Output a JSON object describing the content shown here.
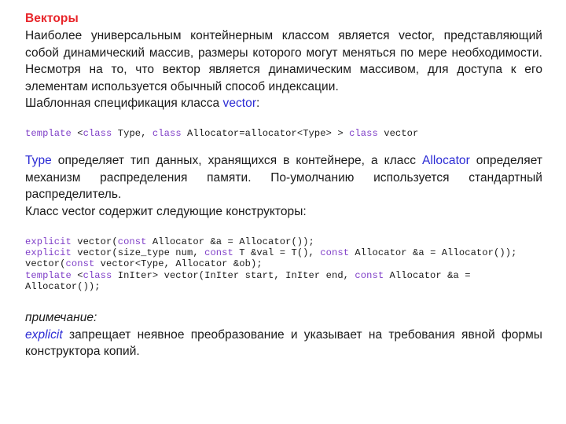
{
  "slide": {
    "title": "Векторы",
    "colors": {
      "title_red": "#e8252a",
      "identifier_blue": "#2b2bd4",
      "code_keyword_purple": "#8040c8",
      "body_text": "#1a1a1a",
      "background": "#ffffff"
    },
    "paragraph_1": {
      "line_1": "Наиболее универсальным контейнерным классом является vector,",
      "line_2": "представляющий собой динамический массив, размеры которого",
      "line_3": "могут меняться по мере необходимости. Несмотря на то, что вектор",
      "line_4": "является динамическим массивом, для доступа к его элементам",
      "line_5": "используется обычный способ индексации.",
      "full": "Наиболее универсальным контейнерным классом является vector, представляющий собой динамический массив, размеры которого могут меняться по мере необходимости. Несмотря на то, что вектор является динамическим массивом, для доступа к его элементам используется обычный способ индексации."
    },
    "spec_intro": {
      "before": "Шаблонная спецификация класса ",
      "identifier": "vector",
      "after": ":"
    },
    "code_block_1": {
      "tokens": [
        {
          "text": "template",
          "style": "keyword"
        },
        {
          "text": " <",
          "style": "plain"
        },
        {
          "text": "class",
          "style": "keyword"
        },
        {
          "text": " Type, ",
          "style": "plain"
        },
        {
          "text": "class",
          "style": "keyword"
        },
        {
          "text": " Allocator=allocator<Type> > ",
          "style": "plain"
        },
        {
          "text": "class",
          "style": "keyword"
        },
        {
          "text": " vector",
          "style": "plain"
        }
      ],
      "plain_text": "template <class Type, class Allocator=allocator<Type> > class vector"
    },
    "paragraph_2": {
      "identifier_1": "Type",
      "mid_1": " определяет тип данных, хранящихся в контейнере, а класс ",
      "identifier_2": "Allocator",
      "mid_2": " определяет механизм распределения памяти. По-умолчанию используется стандартный распределитель.",
      "full": "Type определяет тип данных, хранящихся в контейнере, а класс Allocator определяет механизм распределения памяти. По-умолчанию используется стандартный распределитель."
    },
    "constructors_intro": "Класс vector содержит следующие конструкторы:",
    "code_block_2": {
      "lines": [
        {
          "tokens": [
            {
              "text": "explicit",
              "style": "keyword"
            },
            {
              "text": " vector(",
              "style": "plain"
            },
            {
              "text": "const",
              "style": "keyword"
            },
            {
              "text": " Allocator &a = Allocator());",
              "style": "plain"
            }
          ],
          "plain_text": "explicit vector(const Allocator &a = Allocator());"
        },
        {
          "tokens": [
            {
              "text": "explicit",
              "style": "keyword"
            },
            {
              "text": " vector(size_type num, ",
              "style": "plain"
            },
            {
              "text": "const",
              "style": "keyword"
            },
            {
              "text": " T &val = T(), ",
              "style": "plain"
            },
            {
              "text": "const",
              "style": "keyword"
            },
            {
              "text": " Allocator &a = Allocator());",
              "style": "plain"
            }
          ],
          "plain_text": "explicit vector(size_type num, const T &val = T(), const Allocator &a = Allocator());"
        },
        {
          "tokens": [
            {
              "text": "vector(",
              "style": "plain"
            },
            {
              "text": "const",
              "style": "keyword"
            },
            {
              "text": " vector<Type, Allocator &ob);",
              "style": "plain"
            }
          ],
          "plain_text": "vector(const vector<Type, Allocator &ob);"
        },
        {
          "tokens": [
            {
              "text": "template",
              "style": "keyword"
            },
            {
              "text": " <",
              "style": "plain"
            },
            {
              "text": "class",
              "style": "keyword"
            },
            {
              "text": " InIter> vector(InIter start, InIter end, ",
              "style": "plain"
            },
            {
              "text": "const",
              "style": "keyword"
            },
            {
              "text": " Allocator &a = Allocator());",
              "style": "plain"
            }
          ],
          "plain_text": "template <class InIter> vector(InIter start, InIter end, const Allocator &a = Allocator());"
        }
      ]
    },
    "note": {
      "label": "примечание:",
      "identifier": "explicit",
      "text": " запрещает неявное преобразование и указывает на требования явной формы конструктора копий."
    }
  }
}
